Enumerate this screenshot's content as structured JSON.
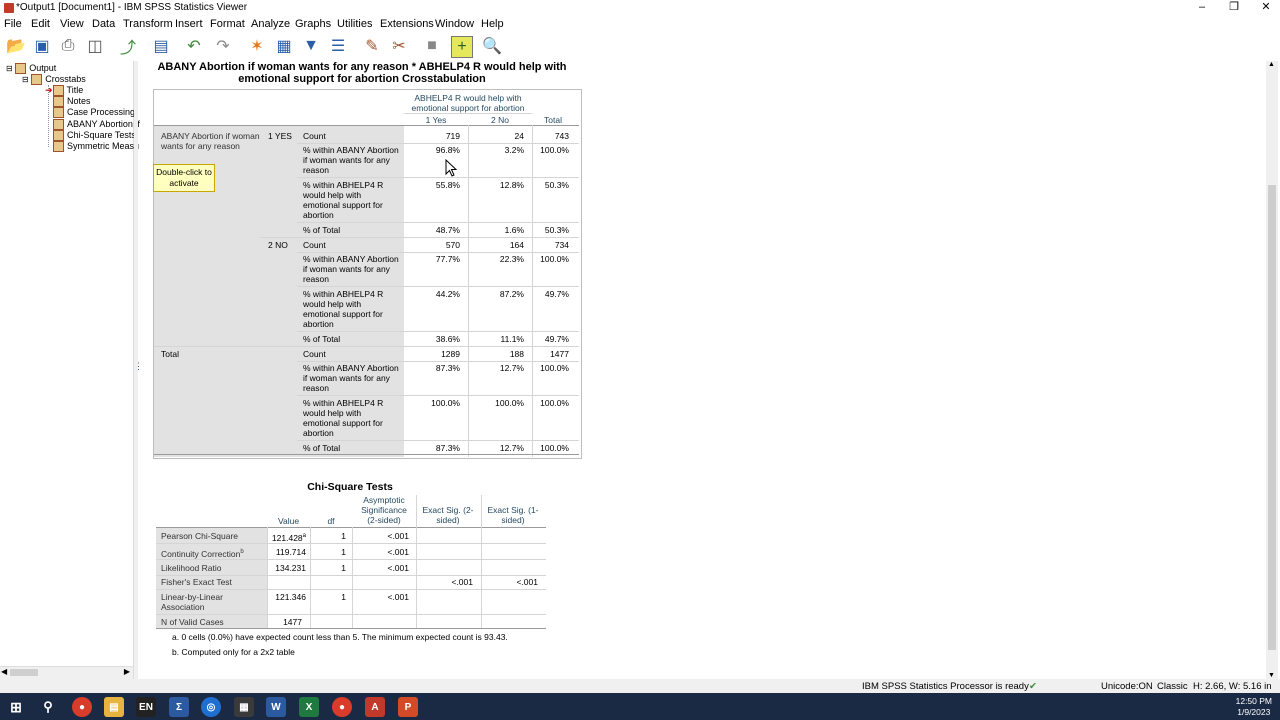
{
  "window": {
    "title": "*Output1 [Document1] - IBM SPSS Statistics Viewer"
  },
  "menu": [
    "File",
    "Edit",
    "View",
    "Data",
    "Transform",
    "Insert",
    "Format",
    "Analyze",
    "Graphs",
    "Utilities",
    "Extensions",
    "Window",
    "Help"
  ],
  "tree": {
    "output": "Output",
    "crosstabs": "Crosstabs",
    "items": [
      "Title",
      "Notes",
      "Case Processing",
      "ABANY Abortion if",
      "Chi-Square Tests",
      "Symmetric Measu"
    ]
  },
  "tooltip": {
    "text1": "Double-click to",
    "text2": "activate"
  },
  "crosstab": {
    "title1": "ABANY Abortion if woman wants for any reason * ABHELP4 R would help with",
    "title2": "emotional support for abortion Crosstabulation",
    "col_header": [
      "ABHELP4 R would help with",
      "emotional support for abortion"
    ],
    "col_labels": [
      "1 Yes",
      "2 No",
      "Total"
    ],
    "row_var": [
      "ABANY Abortion if woman",
      "wants for any reason"
    ],
    "yes_label": "1 YES",
    "no_label": "2 NO",
    "total_label": "Total",
    "stats": {
      "count": "Count",
      "within_row": [
        "% within ABANY Abortion",
        "if woman wants for any",
        "reason"
      ],
      "within_col": [
        "% within ABHELP4 R",
        "would help with",
        "emotional support for",
        "abortion"
      ],
      "of_total": "% of Total"
    },
    "yes": {
      "count": [
        "719",
        "24",
        "743"
      ],
      "within_row": [
        "96.8%",
        "3.2%",
        "100.0%"
      ],
      "within_col": [
        "55.8%",
        "12.8%",
        "50.3%"
      ],
      "of_total": [
        "48.7%",
        "1.6%",
        "50.3%"
      ]
    },
    "no": {
      "count": [
        "570",
        "164",
        "734"
      ],
      "within_row": [
        "77.7%",
        "22.3%",
        "100.0%"
      ],
      "within_col": [
        "44.2%",
        "87.2%",
        "49.7%"
      ],
      "of_total": [
        "38.6%",
        "11.1%",
        "49.7%"
      ]
    },
    "total": {
      "count": [
        "1289",
        "188",
        "1477"
      ],
      "within_row": [
        "87.3%",
        "12.7%",
        "100.0%"
      ],
      "within_col": [
        "100.0%",
        "100.0%",
        "100.0%"
      ],
      "of_total": [
        "87.3%",
        "12.7%",
        "100.0%"
      ]
    }
  },
  "chi": {
    "title": "Chi-Square Tests",
    "headers": {
      "value": "Value",
      "df": "df",
      "asym": [
        "Asymptotic",
        "Significance",
        "(2-sided)"
      ],
      "exact2": [
        "Exact Sig. (2-",
        "sided)"
      ],
      "exact1": [
        "Exact Sig. (1-",
        "sided)"
      ]
    },
    "rows": [
      {
        "label": "Pearson Chi-Square",
        "value": "121.428",
        "sup": "a",
        "df": "1",
        "asym": "<.001",
        "e2": "",
        "e1": ""
      },
      {
        "label": "Continuity Correction",
        "sup_label": "b",
        "value": "119.714",
        "df": "1",
        "asym": "<.001",
        "e2": "",
        "e1": ""
      },
      {
        "label": "Likelihood Ratio",
        "value": "134.231",
        "df": "1",
        "asym": "<.001",
        "e2": "",
        "e1": ""
      },
      {
        "label": "Fisher's Exact Test",
        "value": "",
        "df": "",
        "asym": "",
        "e2": "<.001",
        "e1": "<.001"
      },
      {
        "label": [
          "Linear-by-Linear",
          "Association"
        ],
        "value": "121.346",
        "df": "1",
        "asym": "<.001",
        "e2": "",
        "e1": ""
      },
      {
        "label": "N of Valid Cases",
        "value": "1477",
        "df": "",
        "asym": "",
        "e2": "",
        "e1": ""
      }
    ],
    "footnote_a": "a. 0 cells (0.0%) have expected count less than 5. The minimum expected count is 93.43.",
    "footnote_b": "b. Computed only for a 2x2 table"
  },
  "status": {
    "processor": "IBM SPSS Statistics Processor is ready",
    "unicode": "Unicode:ON",
    "mode": "Classic",
    "size": "H: 2.66, W: 5.16 in"
  },
  "clock": {
    "time": "12:50 PM",
    "date": "1/9/2023"
  },
  "colors": {
    "accent": "#264a60",
    "shade": "#e2e2e2",
    "taskbar": "#1b2a44"
  }
}
